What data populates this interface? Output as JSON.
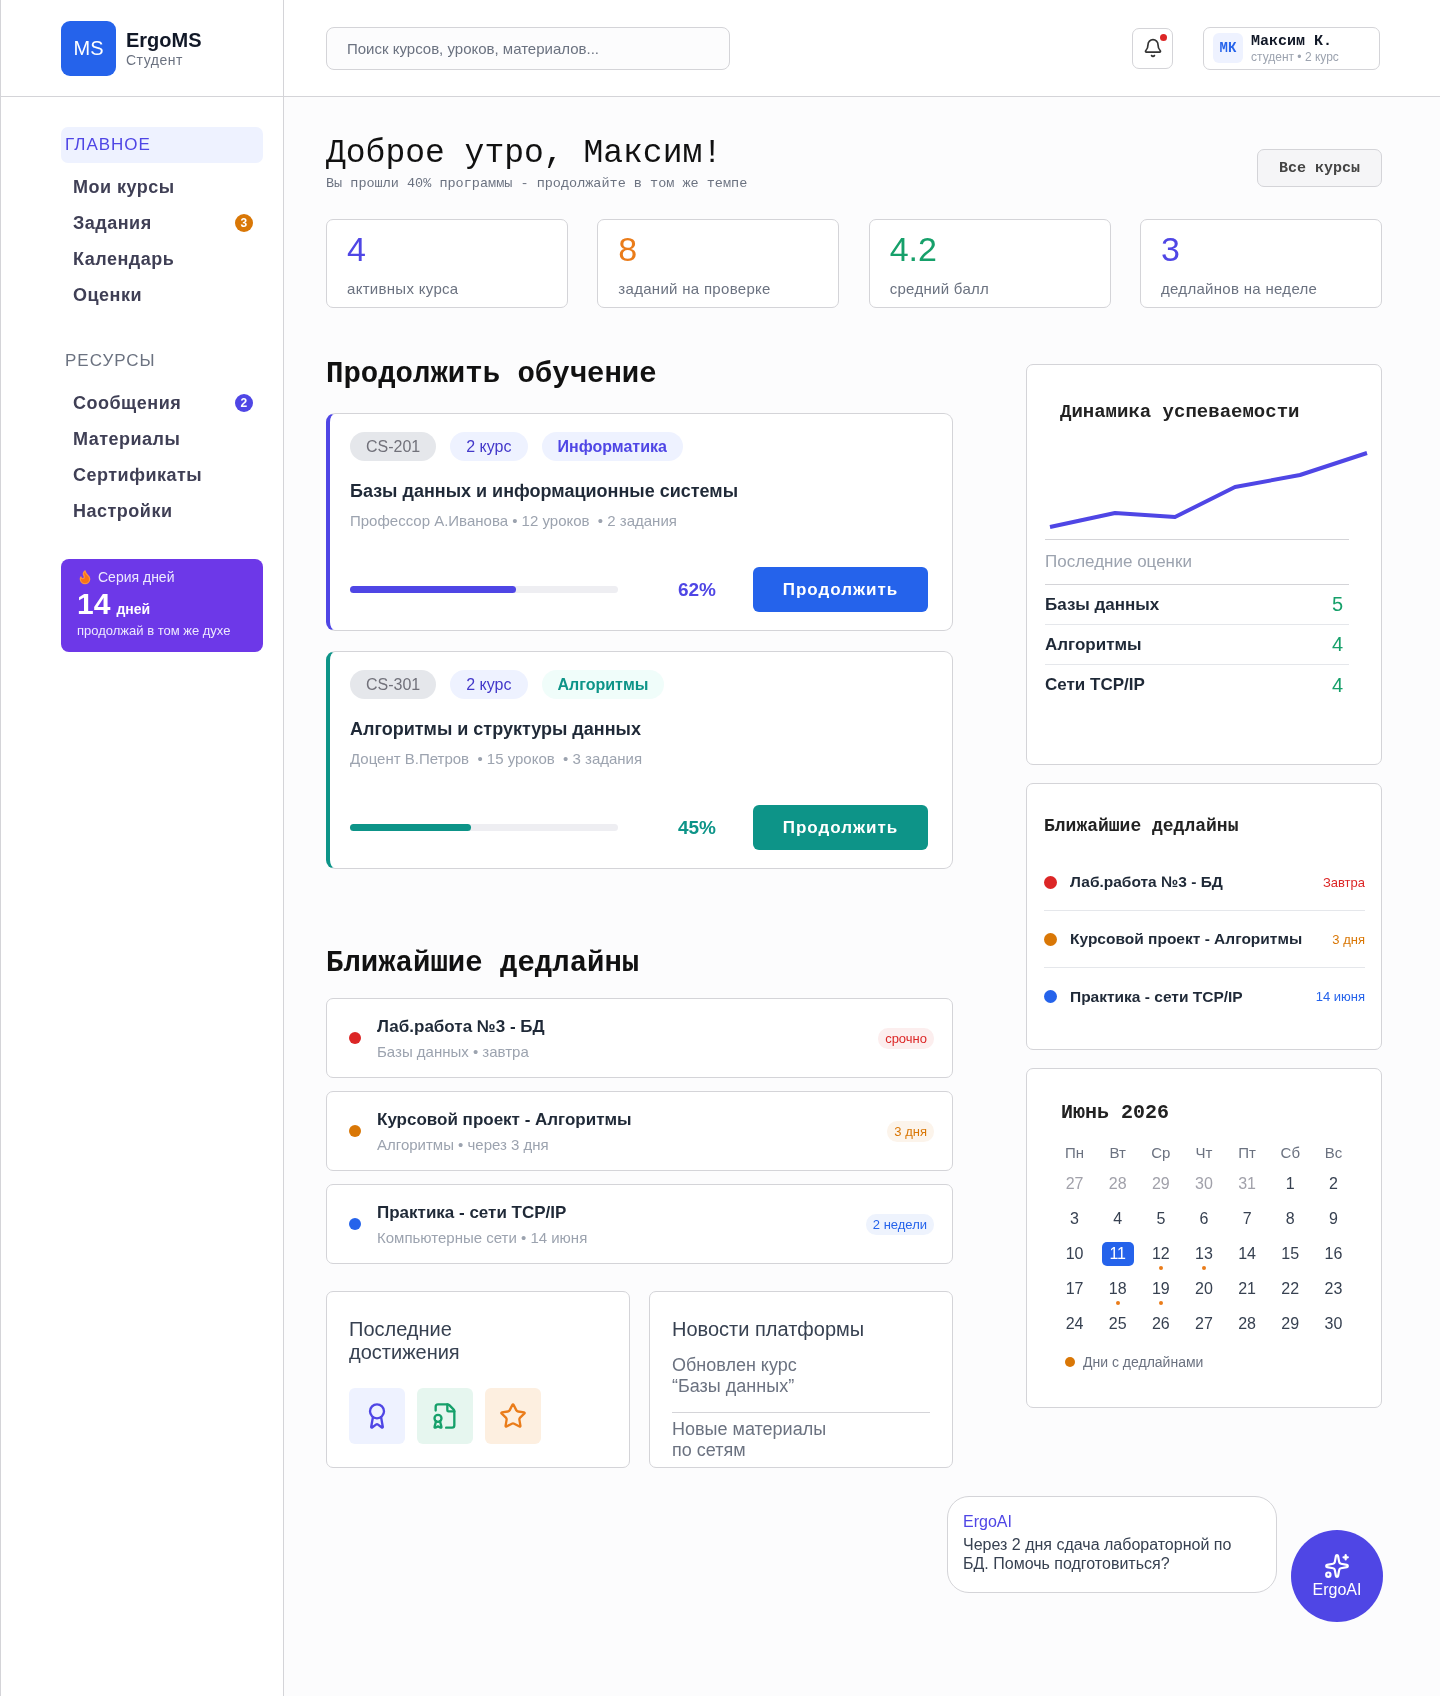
{
  "brand": {
    "logo": "MS",
    "name": "ErgoMS",
    "role": "Студент"
  },
  "search": {
    "placeholder": "Поиск курсов, уроков, материалов..."
  },
  "notifications": {
    "unread": true
  },
  "user": {
    "initials": "МК",
    "name": "Максим К.",
    "info": "студент • 2 курс"
  },
  "sidebar": [
    {
      "title": "ГЛАВНОЕ",
      "selected": true,
      "items": [
        {
          "label": "Мои курсы",
          "selected": false
        },
        {
          "label": "Задания",
          "selected": false,
          "badge": "3",
          "color": "#d97706"
        },
        {
          "label": "Календарь",
          "selected": false
        },
        {
          "label": "Оценки",
          "selected": false
        }
      ]
    },
    {
      "title": "РЕСУРСЫ",
      "selected": false,
      "items": [
        {
          "label": "Сообщения",
          "selected": false,
          "badge": "2",
          "color": "#4f46e5"
        },
        {
          "label": "Материалы",
          "selected": false
        },
        {
          "label": "Сертификаты",
          "selected": false
        },
        {
          "label": "Настройки",
          "selected": false
        }
      ]
    }
  ],
  "streak": {
    "title": "Серия дней",
    "count": "14",
    "unit": "дней",
    "note": "продолжай в том же духе"
  },
  "greeting": {
    "title": "Доброе утро, Максим!",
    "subtitle": "Вы прошли 40% программы - продолжайте в том же темпе",
    "button": "Все курсы"
  },
  "stats": [
    {
      "value": "4",
      "label": "активных курса",
      "color": "#4f46e5"
    },
    {
      "value": "8",
      "label": "заданий на проверке",
      "color": "#ea7c1a"
    },
    {
      "value": "4.2",
      "label": "средний балл",
      "color": "#16a06a"
    },
    {
      "value": "3",
      "label": "дедлайнов на неделе",
      "color": "#4f46e5"
    }
  ],
  "continue": {
    "title": "Продолжить обучение",
    "courses": [
      {
        "kind": "indigo",
        "tags": [
          {
            "kind": "code",
            "text": "CS-201"
          },
          {
            "kind": "year",
            "text": "2 курс"
          },
          {
            "kind": "subject",
            "text": "Информатика"
          }
        ],
        "title": "Базы данных и информационные системы",
        "meta": "Профессор А.Иванова • 12 уроков  • 2 задания",
        "level": 0.62,
        "percent": "62%",
        "button": "Продолжить"
      },
      {
        "kind": "teal",
        "tags": [
          {
            "kind": "code",
            "text": "CS-301"
          },
          {
            "kind": "year",
            "text": "2 курс"
          },
          {
            "kind": "subject",
            "text": "Алгоритмы"
          }
        ],
        "title": "Алгоритмы и структуры данных",
        "meta": "Доцент В.Петров  • 15 уроков  • 3 задания",
        "level": 0.45,
        "percent": "45%",
        "button": "Продолжить"
      }
    ]
  },
  "deadlines": {
    "title": "Ближайшие дедлайны",
    "items": [
      {
        "title": "Лаб.работа №3 - БД",
        "sub": "Базы данных • завтра",
        "badge": "срочно",
        "color": "#dc2626"
      },
      {
        "title": "Курсовой проект - Алгоритмы",
        "sub": "Алгоритмы • через 3 дня",
        "badge": "3 дня",
        "color": "#d97706"
      },
      {
        "title": "Практика - сети TCP/IP",
        "sub": "Компьютерные сети • 14 июня",
        "badge": "2 недели",
        "color": "#2563eb"
      }
    ]
  },
  "achievements": {
    "title": "Последние достижения"
  },
  "news": {
    "title": "Новости платформы",
    "items": [
      "Обновлен курс\n“Базы данных”",
      "Новые материалы\nпо сетям"
    ]
  },
  "performance": {
    "title": "Динамика успеваемости",
    "grades_title": "Последние оценки",
    "grades": [
      {
        "subject": "Базы данных",
        "grade": "5"
      },
      {
        "subject": "Алгоритмы",
        "grade": "4"
      },
      {
        "subject": "Сети TCP/IP",
        "grade": "4"
      }
    ]
  },
  "side_deadlines": {
    "title": "Ближайшие  дедлайны",
    "items": [
      {
        "title": "Лаб.работа №3 - БД",
        "when": "Завтра",
        "color": "#dc2626"
      },
      {
        "title": "Курсовой проект - Алгоритмы",
        "when": "3 дня",
        "color": "#d97706"
      },
      {
        "title": "Практика - сети TCP/IP",
        "when": "14 июня",
        "color": "#2563eb"
      }
    ]
  },
  "calendar": {
    "title": "Июнь 2026",
    "weekdays": [
      "Пн",
      "Вт",
      "Ср",
      "Чт",
      "Пт",
      "Сб",
      "Вс"
    ],
    "days": [
      {
        "d": "27",
        "muted": true,
        "selected": false,
        "deadline": false
      },
      {
        "d": "28",
        "muted": true,
        "selected": false,
        "deadline": false
      },
      {
        "d": "29",
        "muted": true,
        "selected": false,
        "deadline": false
      },
      {
        "d": "30",
        "muted": true,
        "selected": false,
        "deadline": false
      },
      {
        "d": "31",
        "muted": true,
        "selected": false,
        "deadline": false
      },
      {
        "d": "1",
        "muted": false,
        "selected": false,
        "deadline": false
      },
      {
        "d": "2",
        "muted": false,
        "selected": false,
        "deadline": false
      },
      {
        "d": "3",
        "muted": false,
        "selected": false,
        "deadline": false
      },
      {
        "d": "4",
        "muted": false,
        "selected": false,
        "deadline": false
      },
      {
        "d": "5",
        "muted": false,
        "selected": false,
        "deadline": false
      },
      {
        "d": "6",
        "muted": false,
        "selected": false,
        "deadline": false
      },
      {
        "d": "7",
        "muted": false,
        "selected": false,
        "deadline": false
      },
      {
        "d": "8",
        "muted": false,
        "selected": false,
        "deadline": false
      },
      {
        "d": "9",
        "muted": false,
        "selected": false,
        "deadline": false
      },
      {
        "d": "10",
        "muted": false,
        "selected": false,
        "deadline": false
      },
      {
        "d": "11",
        "muted": false,
        "selected": true,
        "deadline": false
      },
      {
        "d": "12",
        "muted": false,
        "selected": false,
        "deadline": true
      },
      {
        "d": "13",
        "muted": false,
        "selected": false,
        "deadline": true
      },
      {
        "d": "14",
        "muted": false,
        "selected": false,
        "deadline": false
      },
      {
        "d": "15",
        "muted": false,
        "selected": false,
        "deadline": false
      },
      {
        "d": "16",
        "muted": false,
        "selected": false,
        "deadline": false
      },
      {
        "d": "17",
        "muted": false,
        "selected": false,
        "deadline": false
      },
      {
        "d": "18",
        "muted": false,
        "selected": false,
        "deadline": true
      },
      {
        "d": "19",
        "muted": false,
        "selected": false,
        "deadline": true
      },
      {
        "d": "20",
        "muted": false,
        "selected": false,
        "deadline": false
      },
      {
        "d": "21",
        "muted": false,
        "selected": false,
        "deadline": false
      },
      {
        "d": "22",
        "muted": false,
        "selected": false,
        "deadline": false
      },
      {
        "d": "23",
        "muted": false,
        "selected": false,
        "deadline": false
      },
      {
        "d": "24",
        "muted": false,
        "selected": false,
        "deadline": false
      },
      {
        "d": "25",
        "muted": false,
        "selected": false,
        "deadline": false
      },
      {
        "d": "26",
        "muted": false,
        "selected": false,
        "deadline": false
      },
      {
        "d": "27",
        "muted": false,
        "selected": false,
        "deadline": false
      },
      {
        "d": "28",
        "muted": false,
        "selected": false,
        "deadline": false
      },
      {
        "d": "29",
        "muted": false,
        "selected": false,
        "deadline": false
      },
      {
        "d": "30",
        "muted": false,
        "selected": false,
        "deadline": false
      }
    ],
    "legend": "Дни с дедлайнами"
  },
  "assistant": {
    "name": "ErgoAI",
    "message": "Через 2 дня сдача лабораторной по БД. Помочь подготовиться?",
    "button": "ErgoAI"
  }
}
